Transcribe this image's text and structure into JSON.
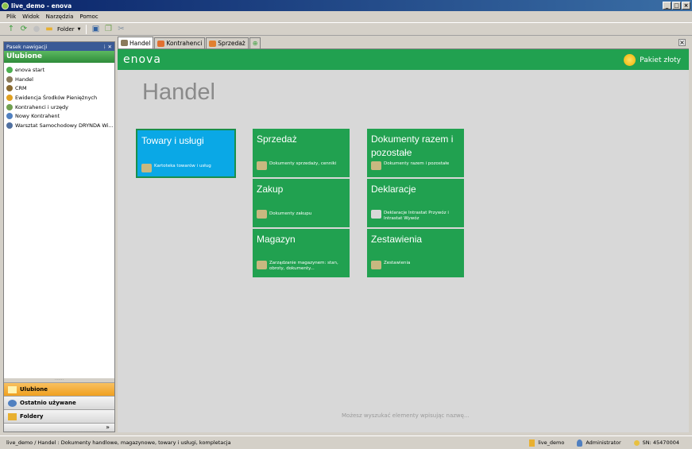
{
  "window": {
    "title": "live_demo - enova"
  },
  "menu": [
    "Plik",
    "Widok",
    "Narzędzia",
    "Pomoc"
  ],
  "toolbar": {
    "folder_label": "Folder"
  },
  "nav": {
    "header": "Pasek nawigacji",
    "section": "Ulubione",
    "items": [
      {
        "label": "enova start",
        "icon": "enova-icon",
        "color": "#4caf50"
      },
      {
        "label": "Handel",
        "icon": "coins-icon",
        "color": "#8a7a5a"
      },
      {
        "label": "CRM",
        "icon": "phone-icon",
        "color": "#8a6a30"
      },
      {
        "label": "Ewidencja Środków Pieniężnych",
        "icon": "money-icon",
        "color": "#e0a020"
      },
      {
        "label": "Kontrahenci i urzędy",
        "icon": "handshake-icon",
        "color": "#70a050"
      },
      {
        "label": "Nowy Kontrahent",
        "icon": "document-icon",
        "color": "#5080c0"
      },
      {
        "label": "Warsztat Samochodowy DRYNDA Wi...",
        "icon": "calculator-icon",
        "color": "#5070a0"
      }
    ],
    "buttons": [
      {
        "label": "Ulubione",
        "active": true
      },
      {
        "label": "Ostatnio używane",
        "active": false
      },
      {
        "label": "Foldery",
        "active": false
      }
    ]
  },
  "tabs": [
    {
      "label": "Handel",
      "active": true
    },
    {
      "label": "Kontrahenci",
      "active": false
    },
    {
      "label": "Sprzedaż",
      "active": false
    }
  ],
  "content": {
    "logo": "enova",
    "package": "Pakiet złoty",
    "title": "Handel",
    "hint": "Możesz wyszukać elementy wpisując nazwę...",
    "accent": "#21a150",
    "selected_tile_color": "#0aa8e6"
  },
  "tiles": [
    {
      "title": "Towary i usługi",
      "desc": "Kartoteka towarów i usług"
    },
    {
      "title": "Sprzedaż",
      "desc": "Dokumenty sprzedaży, cenniki"
    },
    {
      "title": "Dokumenty razem i pozostałe",
      "desc": "Dokumenty razem i pozostałe"
    },
    {
      "title": "Zakup",
      "desc": "Dokumenty zakupu"
    },
    {
      "title": "Deklaracje",
      "desc": "Deklaracje Intrastat Przywóz i Intrastat Wywóz"
    },
    {
      "title": "Magazyn",
      "desc": "Zarządzanie magazynem: stan, obroty, dokumenty..."
    },
    {
      "title": "Zestawienia",
      "desc": "Zestawienia"
    }
  ],
  "status": {
    "path": "live_demo / Handel : Dokumenty handlowe, magazynowe, towary i usługi, kompletacja",
    "db": "live_demo",
    "user": "Administrator",
    "serial": "SN: 45470004"
  }
}
